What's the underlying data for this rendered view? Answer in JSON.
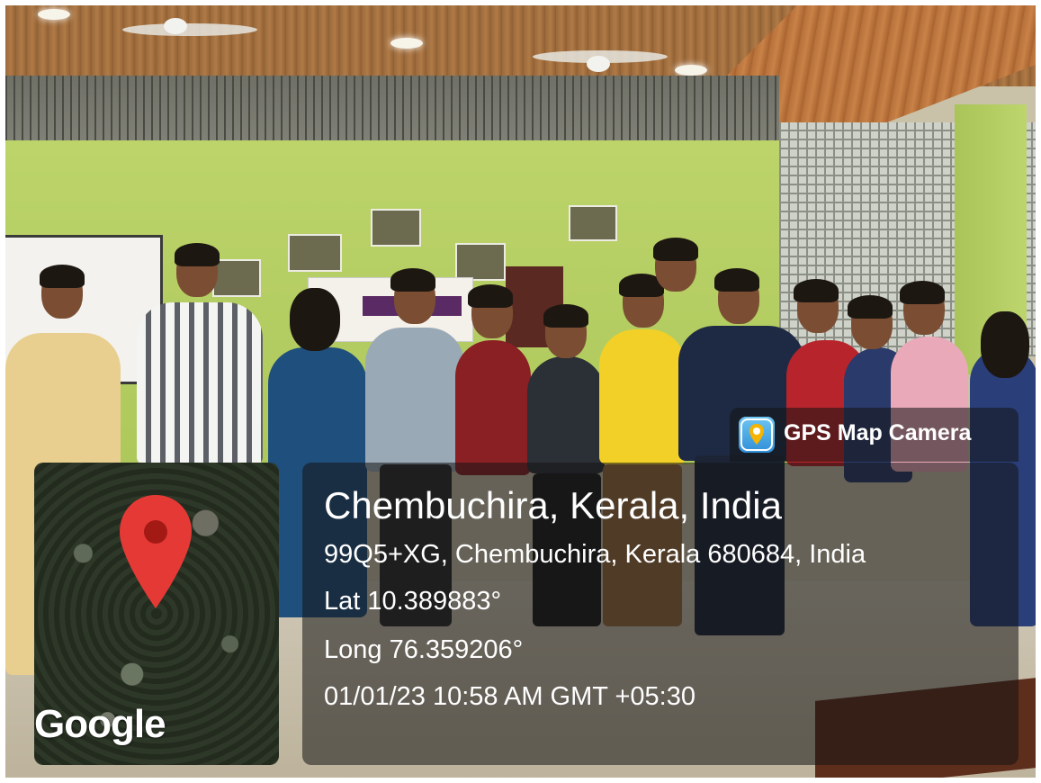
{
  "overlay": {
    "badge_label": "GPS Map Camera",
    "location_title": "Chembuchira, Kerala, India",
    "address": "99Q5+XG, Chembuchira, Kerala 680684, India",
    "latitude": "Lat 10.389883°",
    "longitude": "Long 76.359206°",
    "datetime": "01/01/23 10:58 AM GMT +05:30",
    "map_brand": "Google"
  },
  "colors": {
    "pin_red": "#e53935",
    "pin_dark": "#a31a15",
    "panel_bg": "rgba(20,20,20,0.55)",
    "text": "#ffffff"
  },
  "icons": {
    "badge_icon": "gps-map-camera-app-icon",
    "map_pin": "location-pin-icon"
  }
}
